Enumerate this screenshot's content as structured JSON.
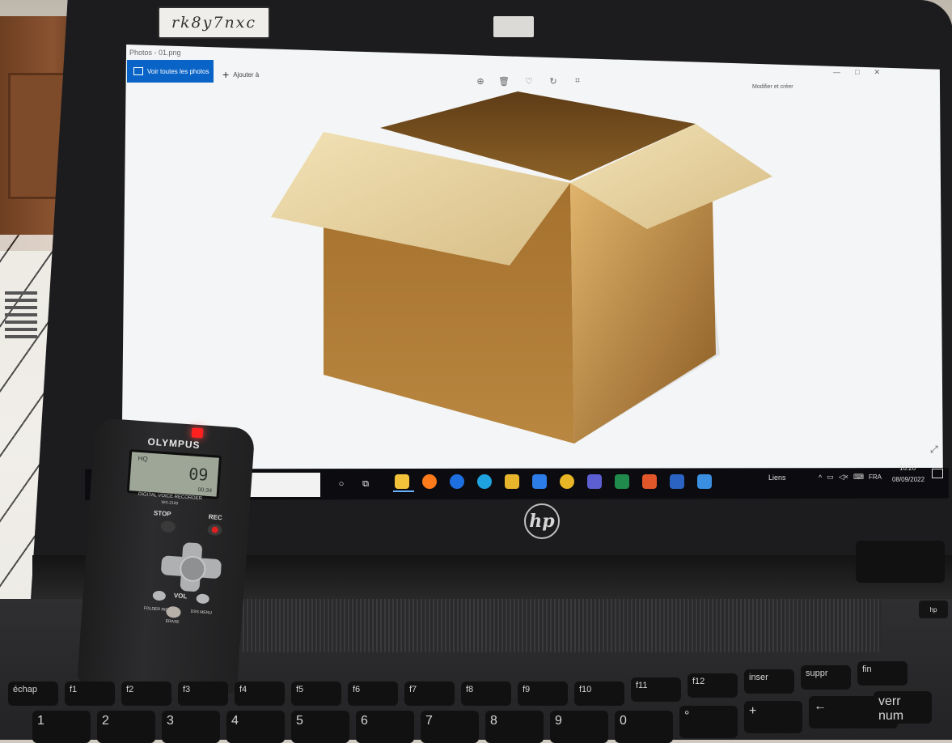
{
  "sticker": {
    "text": "rk8y7nxc"
  },
  "photos_app": {
    "title": "Photos - 01.png",
    "view_all_label": "Voir toutes les photos",
    "add_to_label": "Ajouter à",
    "edit_label": "Modifier et créer",
    "window_controls": [
      "—",
      "□",
      "✕"
    ]
  },
  "taskbar": {
    "liens_label": "Liens",
    "language": "FRA",
    "time": "16:26",
    "date": "08/09/2022",
    "apps": [
      {
        "name": "file-explorer",
        "color": "#f2c23a"
      },
      {
        "name": "firefox",
        "color": "#ff7a1a"
      },
      {
        "name": "app-blue-circle",
        "color": "#1e6fe0"
      },
      {
        "name": "edge",
        "color": "#1fa3e0"
      },
      {
        "name": "app-dots",
        "color": "#e6b52b"
      },
      {
        "name": "dropbox",
        "color": "#2c7de8"
      },
      {
        "name": "chrome",
        "color": "#e8b526"
      },
      {
        "name": "teams",
        "color": "#5c5fd1"
      },
      {
        "name": "excel",
        "color": "#1f8a4c"
      },
      {
        "name": "app-orange",
        "color": "#e2572a"
      },
      {
        "name": "word",
        "color": "#2b63c2"
      },
      {
        "name": "photos",
        "color": "#3a8fe0"
      }
    ]
  },
  "laptop": {
    "brand": "hp",
    "hp_key_label": "hp"
  },
  "keyboard": {
    "row1": [
      "échap",
      "f1",
      "f2",
      "f3",
      "f4",
      "f5",
      "f6",
      "f7",
      "f8",
      "f9",
      "f10",
      "f11",
      "f12",
      "inser",
      "suppr",
      "fin"
    ],
    "row2": [
      "1",
      "2",
      "3",
      "4",
      "5",
      "6",
      "7",
      "8",
      "9",
      "0",
      "°",
      "+",
      "←",
      "verr num"
    ]
  },
  "recorder": {
    "brand": "OLYMPUS",
    "model_line1": "DIGITAL VOICE RECORDER",
    "model_line2": "WS-2100",
    "lcd_folder": "HQ",
    "lcd_digits": "09",
    "lcd_time": "00:34",
    "stop_label": "STOP",
    "rec_label": "REC",
    "vol_label": "VOL",
    "folder_label": "FOLDER INDEX",
    "dss_menu_label": "DSS MENU",
    "erase_label": "ERASE"
  }
}
